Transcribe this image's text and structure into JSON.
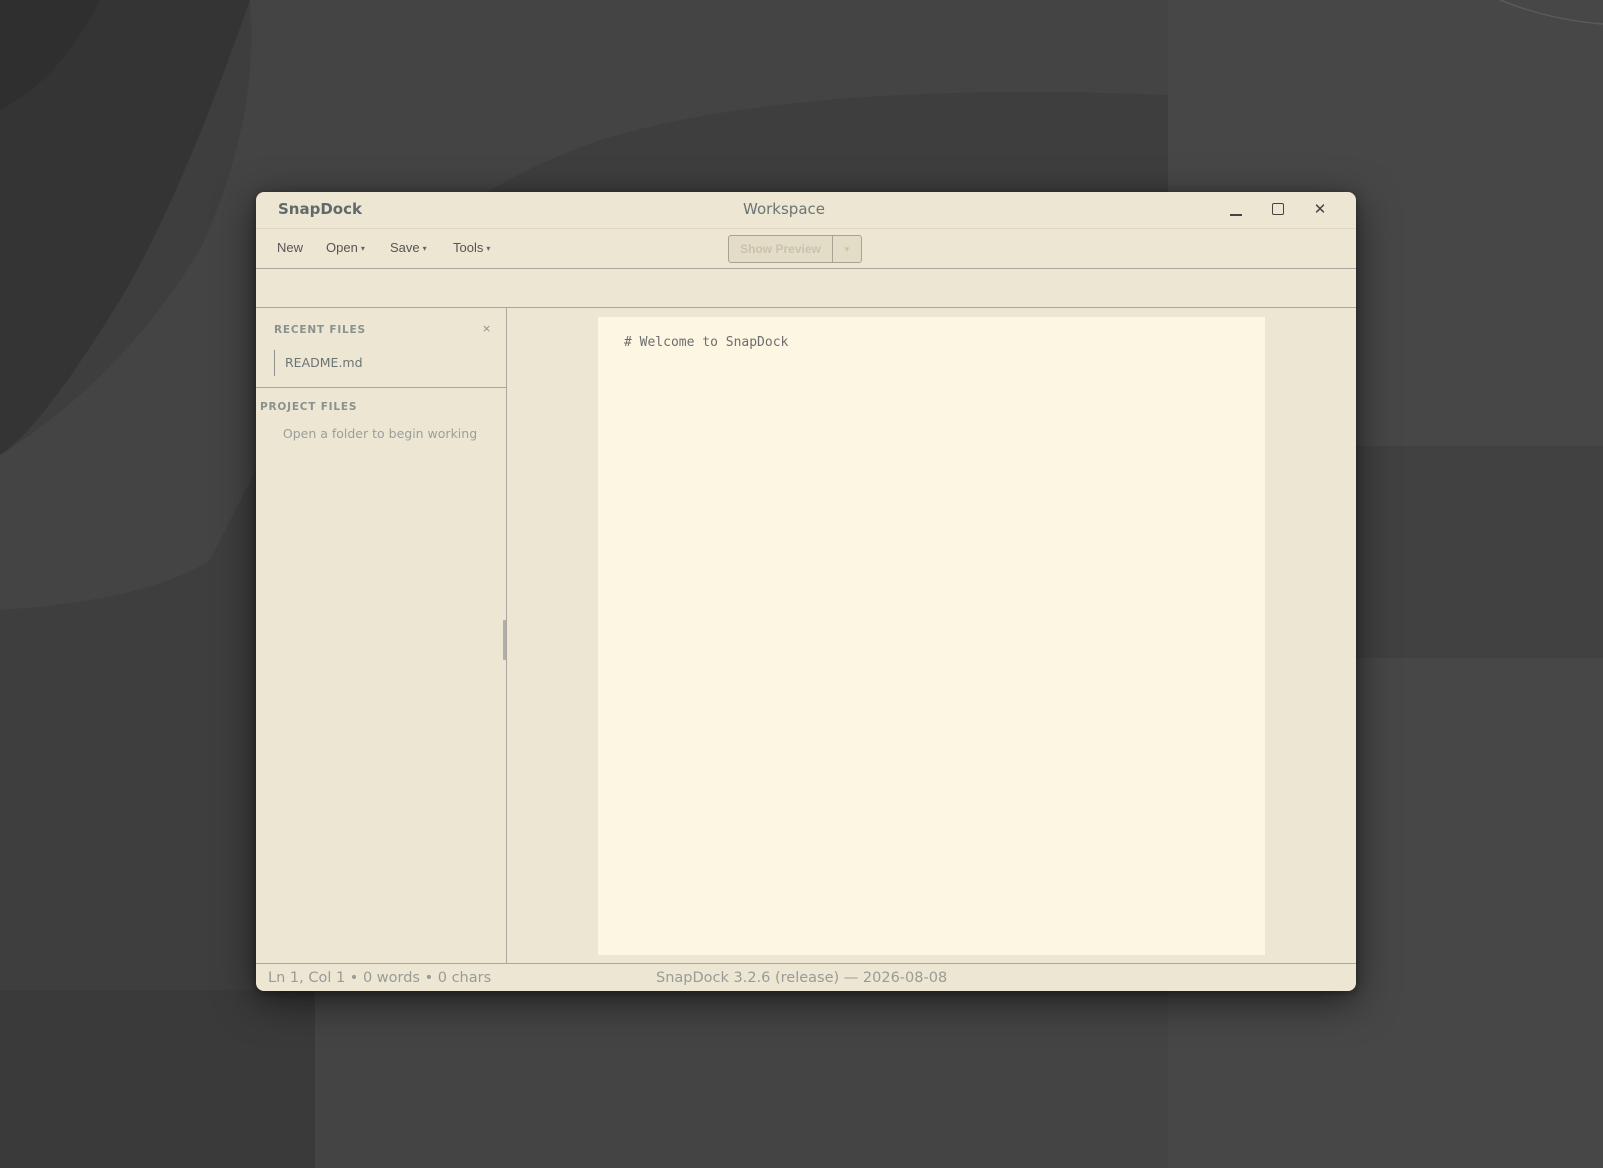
{
  "window": {
    "app_name": "SnapDock",
    "title": "Workspace"
  },
  "toolbar": {
    "new_label": "New",
    "open_label": "Open",
    "save_label": "Save",
    "tools_label": "Tools",
    "dropdown_caret": "▾",
    "preview_label": "Show Preview"
  },
  "sidebar": {
    "recent_title": "RECENT FILES",
    "recent_close": "×",
    "recent_items": [
      {
        "label": "README.md"
      }
    ],
    "project_title": "PROJECT FILES",
    "project_empty": "Open a folder to begin working"
  },
  "editor": {
    "content": "# Welcome to SnapDock"
  },
  "statusbar": {
    "position": "Ln 1, Col 1 • 0 words • 0 chars",
    "version": "SnapDock 3.2.6 (release) — 2026-08-08"
  },
  "icons": {
    "minimize": "minimize-icon",
    "maximize": "maximize-icon",
    "close": "close-icon"
  },
  "colors": {
    "window_bg": "#ede6d3",
    "paper_bg": "#fdf6e3",
    "desktop_bg": "#3d3d3d"
  }
}
